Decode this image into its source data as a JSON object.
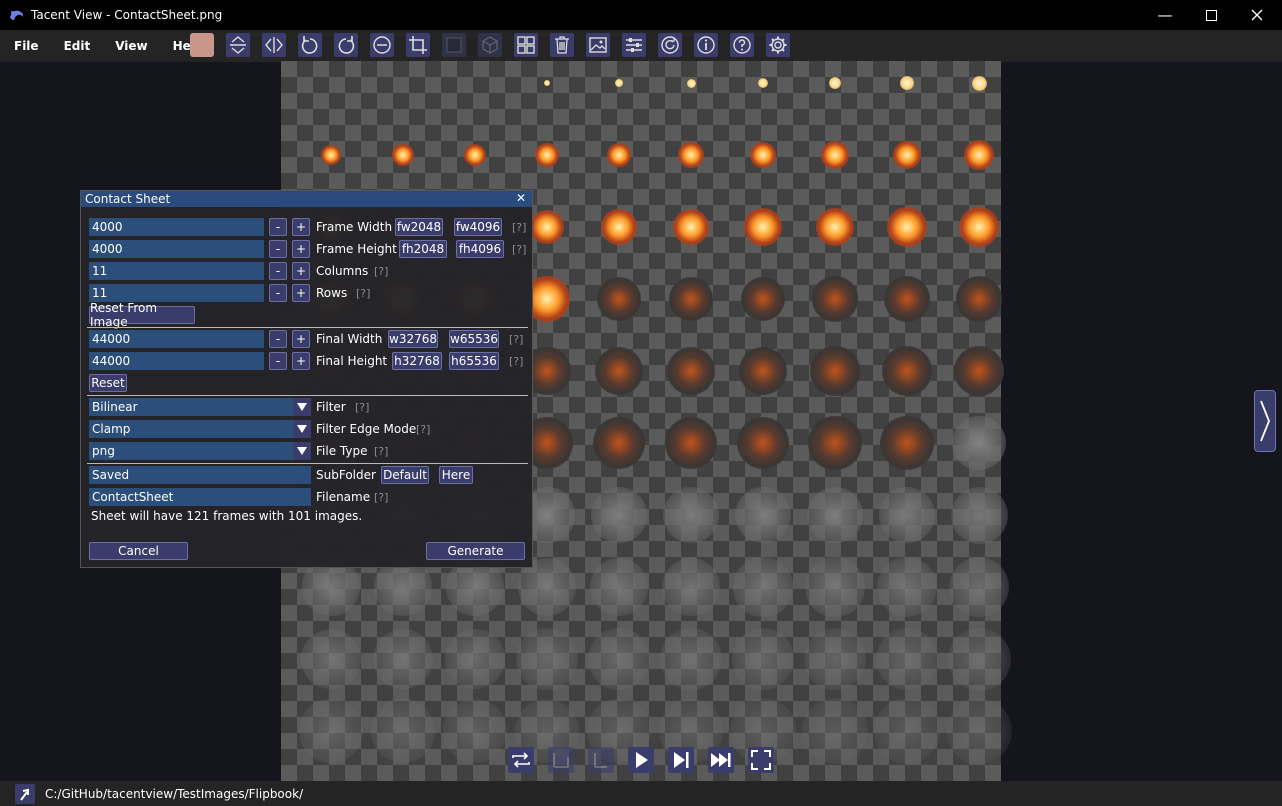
{
  "window": {
    "title": "Tacent View - ContactSheet.png"
  },
  "menu": [
    "File",
    "Edit",
    "View",
    "Help"
  ],
  "toolbar": {
    "swatch_color": "#c9968a"
  },
  "dialog": {
    "title": "Contact Sheet",
    "frame_width": {
      "value": "4000",
      "label": "Frame Width",
      "preset1": "fw2048",
      "preset2": "fw4096",
      "help": "[?]"
    },
    "frame_height": {
      "value": "4000",
      "label": "Frame Height",
      "preset1": "fh2048",
      "preset2": "fh4096",
      "help": "[?]"
    },
    "columns": {
      "value": "11",
      "label": "Columns",
      "help": "[?]"
    },
    "rows": {
      "value": "11",
      "label": "Rows",
      "help": "[?]"
    },
    "reset_from_image": "Reset From Image",
    "final_width": {
      "value": "44000",
      "label": "Final Width",
      "preset1": "w32768",
      "preset2": "w65536",
      "help": "[?]"
    },
    "final_height": {
      "value": "44000",
      "label": "Final Height",
      "preset1": "h32768",
      "preset2": "h65536",
      "help": "[?]"
    },
    "reset": "Reset",
    "filter": {
      "value": "Bilinear",
      "label": "Filter",
      "help": "[?]"
    },
    "edge_mode": {
      "value": "Clamp",
      "label": "Filter Edge Mode",
      "help": "[?]"
    },
    "file_type": {
      "value": "png",
      "label": "File Type",
      "help": "[?]"
    },
    "subfolder": {
      "value": "Saved",
      "label": "SubFolder",
      "default": "Default",
      "here": "Here"
    },
    "filename": {
      "value": "ContactSheet",
      "label": "Filename",
      "help": "[?]"
    },
    "summary": "Sheet will have 121 frames with 101 images.",
    "cancel": "Cancel",
    "generate": "Generate",
    "minus": "-",
    "plus": "+"
  },
  "status": {
    "path": "C:/GitHub/tacentview/TestImages/Flipbook/"
  }
}
